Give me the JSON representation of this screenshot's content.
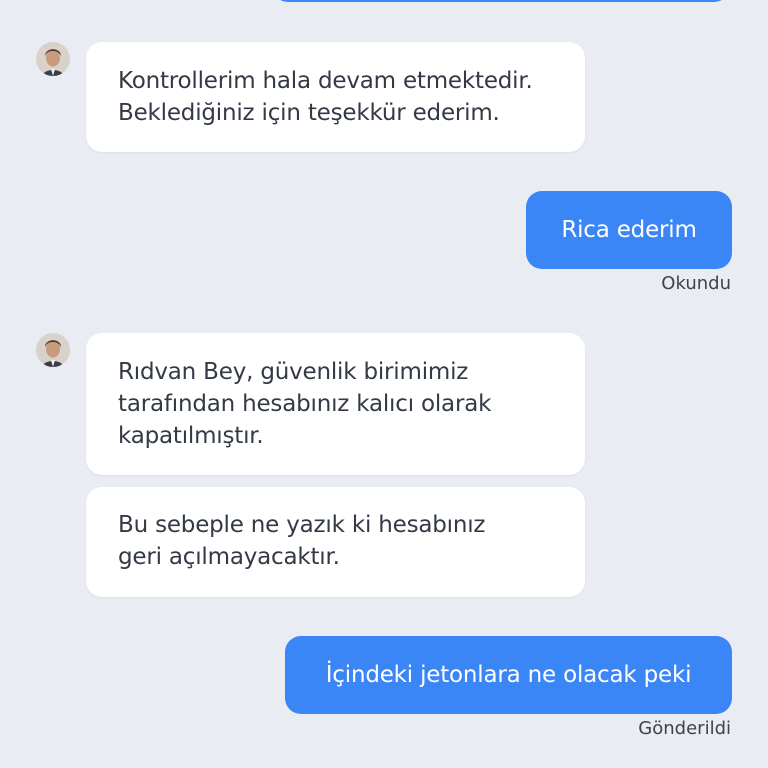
{
  "messages": {
    "agent_1": {
      "lines": [
        "Kontrollerim hala devam etmektedir.",
        "Beklediğiniz için teşekkür ederim."
      ]
    },
    "user_1": {
      "text": "Rica ederim",
      "status": "Okundu"
    },
    "agent_2": {
      "lines": [
        "Rıdvan Bey, güvenlik birimimiz",
        "tarafından hesabınız kalıcı olarak",
        "kapatılmıştır."
      ]
    },
    "agent_3": {
      "lines": [
        "Bu sebeple ne yazık ki hesabınız",
        "geri açılmayacaktır."
      ]
    },
    "user_2": {
      "text": "İçindeki jetonlara ne olacak peki",
      "status": "Gönderildi"
    }
  },
  "colors": {
    "background": "#e9edf3",
    "outgoing_bubble": "#3b86f6",
    "incoming_bubble": "#ffffff",
    "incoming_text": "#333a45"
  },
  "icons": {
    "agent_avatar": "agent-avatar"
  }
}
